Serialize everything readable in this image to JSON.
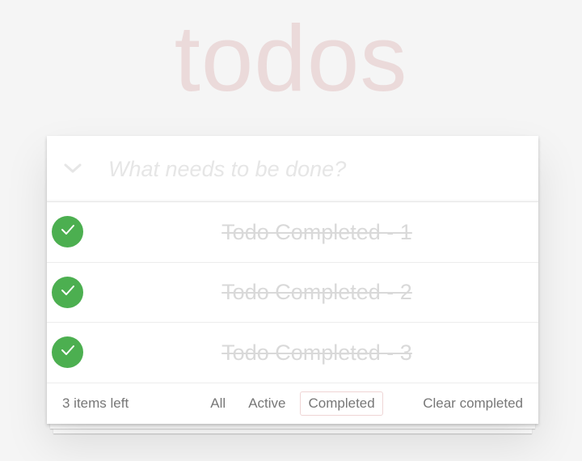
{
  "app": {
    "title": "todos"
  },
  "header": {
    "new_todo_placeholder": "What needs to be done?",
    "new_todo_value": ""
  },
  "todos": [
    {
      "label": "Todo Completed - 1",
      "completed": true
    },
    {
      "label": "Todo Completed - 2",
      "completed": true
    },
    {
      "label": "Todo Completed - 3",
      "completed": true
    }
  ],
  "footer": {
    "count_text": "3 items left",
    "filters": [
      {
        "label": "All",
        "selected": false
      },
      {
        "label": "Active",
        "selected": false
      },
      {
        "label": "Completed",
        "selected": true
      }
    ],
    "clear_completed_label": "Clear completed"
  },
  "colors": {
    "title": "#ebdada",
    "check_complete": "#4caf50",
    "completed_text": "#d9d9d9",
    "selected_filter_border": "#efd5d5",
    "background": "#f5f5f5"
  },
  "icons": {
    "toggle_all": "chevron-down-icon",
    "todo_check": "checkmark-icon"
  }
}
